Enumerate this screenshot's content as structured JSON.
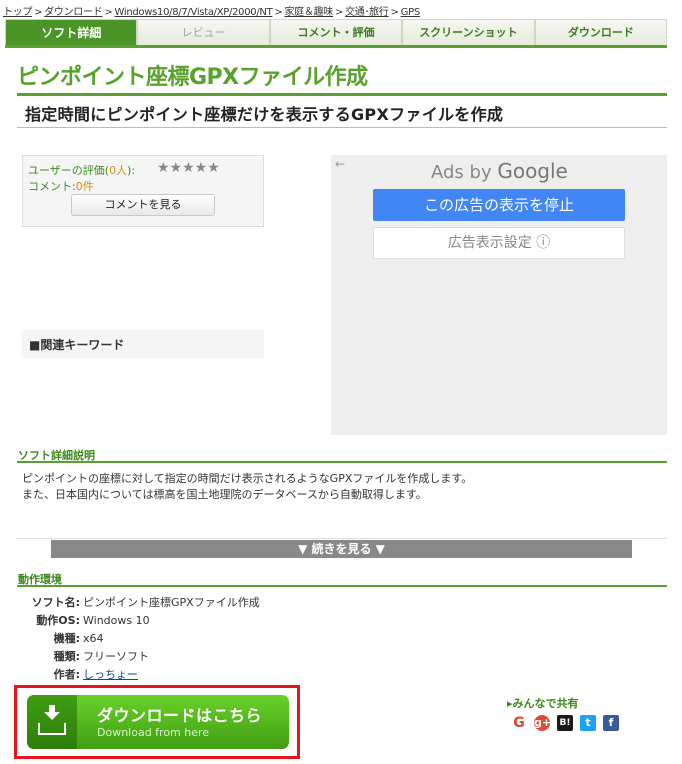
{
  "breadcrumb": [
    "トップ",
    "ダウンロード",
    "Windows10/8/7/Vista/XP/2000/NT",
    "家庭＆趣味",
    "交通･旅行",
    "GPS"
  ],
  "breadcrumb_sep": ">",
  "tabs": [
    {
      "label": "ソフト詳細",
      "active": true
    },
    {
      "label": "レビュー"
    },
    {
      "label": "コメント・評価"
    },
    {
      "label": "スクリーンショット"
    },
    {
      "label": "ダウンロード"
    }
  ],
  "title": "ピンポイント座標GPXファイル作成",
  "subtitle": "指定時間にピンポイント座標だけを表示するGPXファイルを作成",
  "rating": {
    "label": "ユーザーの評価(",
    "count": "0人",
    "label_end": "):",
    "stars": "★★★★★",
    "comment_label": "コメント:",
    "comment_count": "0件",
    "comment_button": "コメントを見る"
  },
  "keywords_label": "■関連キーワード",
  "ad": {
    "back": "←",
    "ads_by": "Ads by ",
    "google": "Google",
    "stop": "この広告の表示を停止",
    "settings": "広告表示設定 ⓘ"
  },
  "desc_heading": "ソフト詳細説明",
  "desc_lines": [
    "ピンポイントの座標に対して指定の時間だけ表示されるようなGPXファイルを作成します。",
    "また、日本国内については標高を国土地理院のデータベースから自動取得します。"
  ],
  "more_button": "▼ 続きを見る ▼",
  "env_heading": "動作環境",
  "spec": {
    "software_label": "ソフト名:",
    "software": "ピンポイント座標GPXファイル作成",
    "os_label": "動作OS:",
    "os": "Windows 10",
    "model_label": "機種:",
    "model": "x64",
    "type_label": "種類:",
    "type": "フリーソフト",
    "author_label": "作者:",
    "author": "しっちょー"
  },
  "download": {
    "main": "ダウンロードはこちら",
    "sub": "Download from here"
  },
  "share": {
    "title": "▸みんなで共有",
    "icons": [
      "G",
      "g+",
      "B!",
      "t",
      "f"
    ]
  }
}
